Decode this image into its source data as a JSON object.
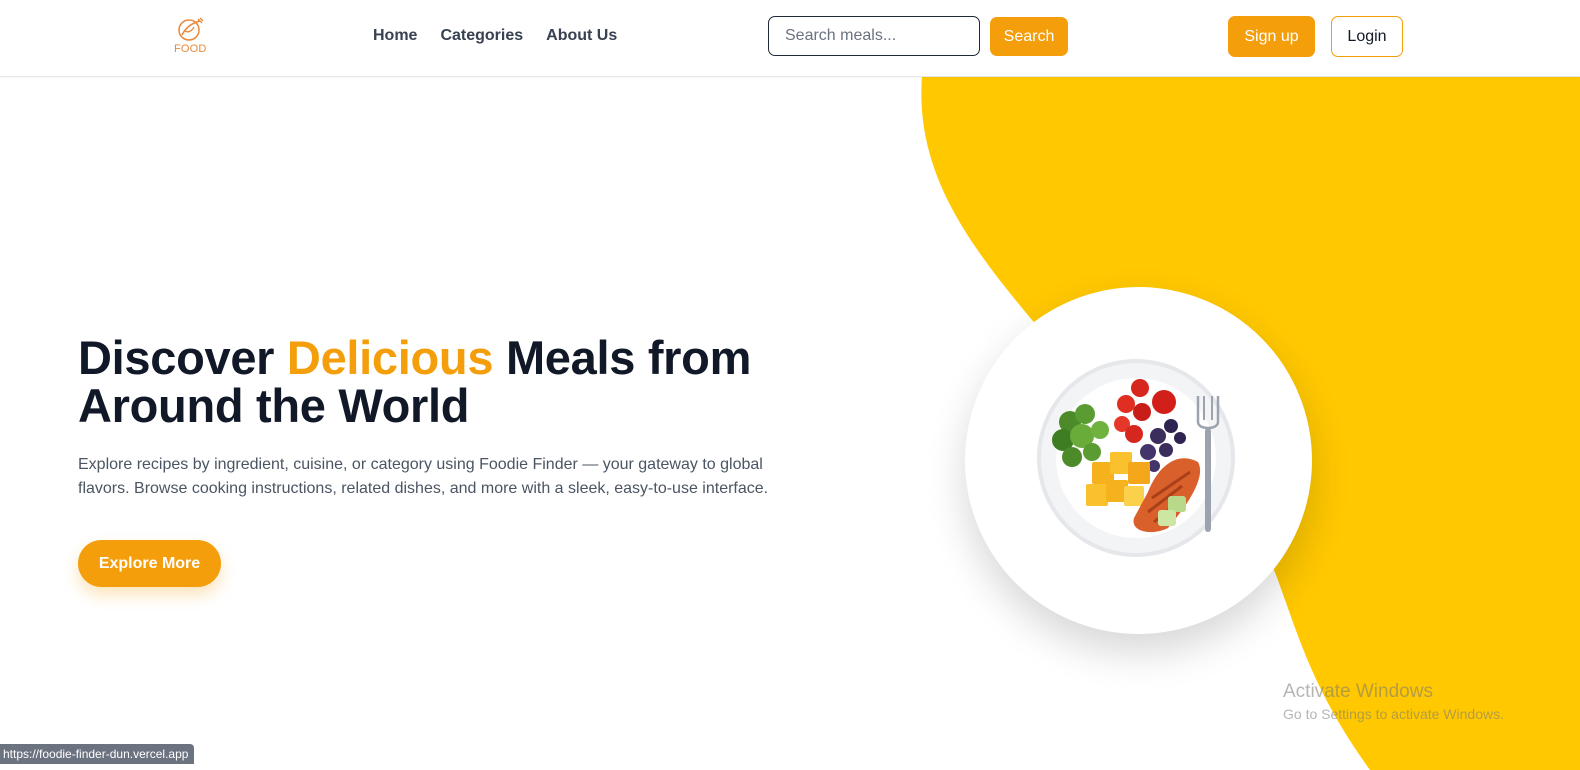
{
  "brand": {
    "logo_text": "FOOD",
    "logo_icon": "fork-and-leaf-icon"
  },
  "nav": {
    "links": [
      {
        "label": "Home"
      },
      {
        "label": "Categories"
      },
      {
        "label": "About Us"
      }
    ]
  },
  "search": {
    "placeholder": "Search meals...",
    "value": "",
    "button_label": "Search"
  },
  "auth": {
    "signup_label": "Sign up",
    "login_label": "Login"
  },
  "hero": {
    "title_part1": "Discover ",
    "title_accent": "Delicious",
    "title_part2": " Meals from Around the World",
    "description": "Explore recipes by ingredient, cuisine, or category using Foodie Finder — your gateway to global flavors. Browse cooking instructions, related dishes, and more with a sleek, easy-to-use interface.",
    "cta_label": "Explore More"
  },
  "watermark": {
    "title": "Activate Windows",
    "subtitle": "Go to Settings to activate Windows."
  },
  "status_bar": {
    "url": "https://foodie-finder-dun.vercel.app"
  },
  "colors": {
    "accent": "#f59e0b",
    "blob": "#ffc800",
    "text_dark": "#111827",
    "text_muted": "#4b5563"
  }
}
